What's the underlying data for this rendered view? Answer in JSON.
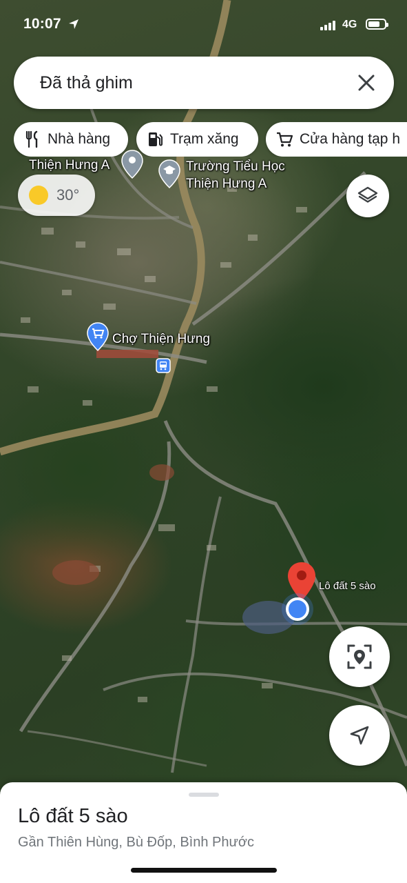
{
  "status_bar": {
    "time": "10:07",
    "network": "4G"
  },
  "search": {
    "text": "Đã thả ghim",
    "close_icon": "close-icon"
  },
  "chips": [
    {
      "label": "Nhà hàng",
      "icon": "restaurant-icon"
    },
    {
      "label": "Trạm xăng",
      "icon": "gas-station-icon"
    },
    {
      "label": "Cửa hàng tạp h",
      "icon": "shopping-cart-icon"
    }
  ],
  "weather": {
    "temperature": "30°",
    "icon": "sun-icon"
  },
  "map": {
    "labels": {
      "thien_hung_a": "Thiện Hưng A",
      "school_line1": "Trường Tiểu Học",
      "school_line2": "Thiện Hưng A",
      "market": "Chợ Thiện Hưng",
      "dropped_pin": "Lô đất 5 sào"
    },
    "colors": {
      "pin_red": "#ea4335",
      "location_blue": "#4285f4",
      "market_pin": "#4285f4",
      "poi_gray": "#8a98a5"
    }
  },
  "place": {
    "title": "Lô đất 5 sào",
    "address": "Gần Thiên Hùng, Bù Đốp, Bình Phước"
  }
}
